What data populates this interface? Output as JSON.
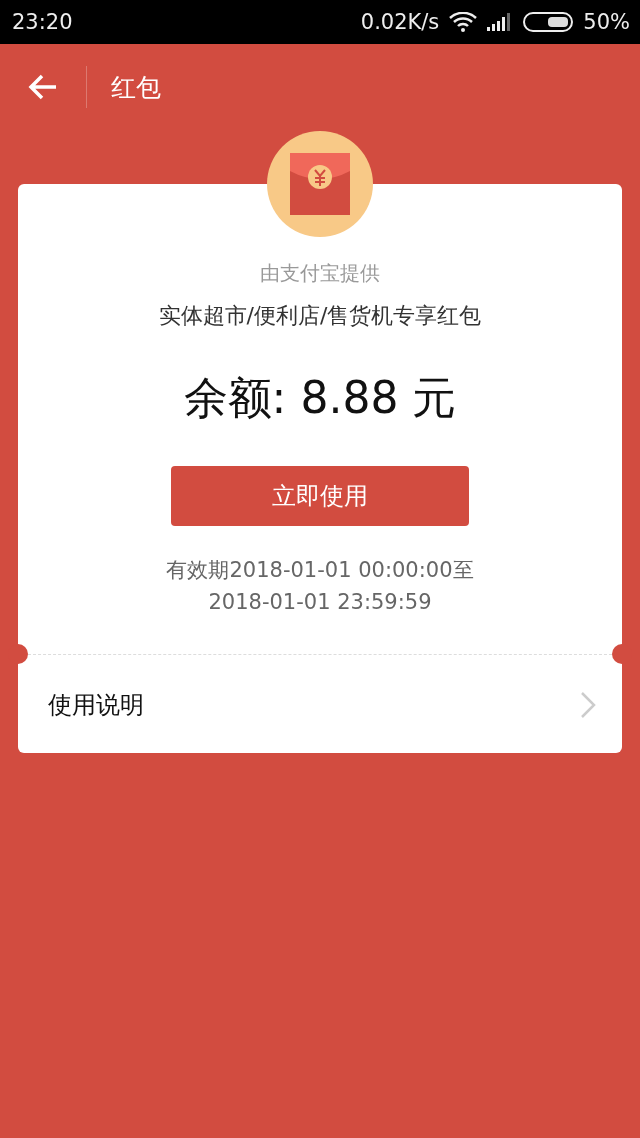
{
  "status_bar": {
    "time": "23:20",
    "speed": "0.02K/s",
    "battery": "50%"
  },
  "app_bar": {
    "title": "红包"
  },
  "card": {
    "provider": "由支付宝提供",
    "subtitle": "实体超市/便利店/售货机专享红包",
    "balance": "余额: 8.88 元",
    "button": "立即使用",
    "validity": "有效期2018-01-01 00:00:00至\n2018-01-01 23:59:59",
    "instructions": "使用说明"
  }
}
